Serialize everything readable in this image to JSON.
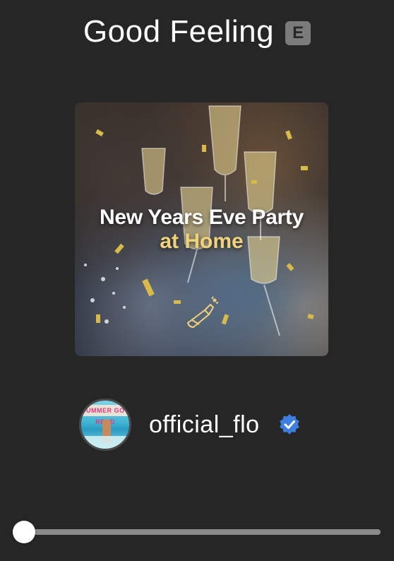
{
  "song": {
    "title": "Good Feeling",
    "explicit_badge": "E"
  },
  "cover": {
    "line1": "New Years Eve Party",
    "line2": "at Home",
    "icon": "champagne-bottle-icon",
    "accent_color": "#f1d27a"
  },
  "artist": {
    "avatar_text": "SUMMER GOT READ",
    "name": "official_flo",
    "verified_icon": "verified-badge-icon",
    "verified_color": "#3d7fe0"
  },
  "playback": {
    "progress_fraction": 0
  }
}
